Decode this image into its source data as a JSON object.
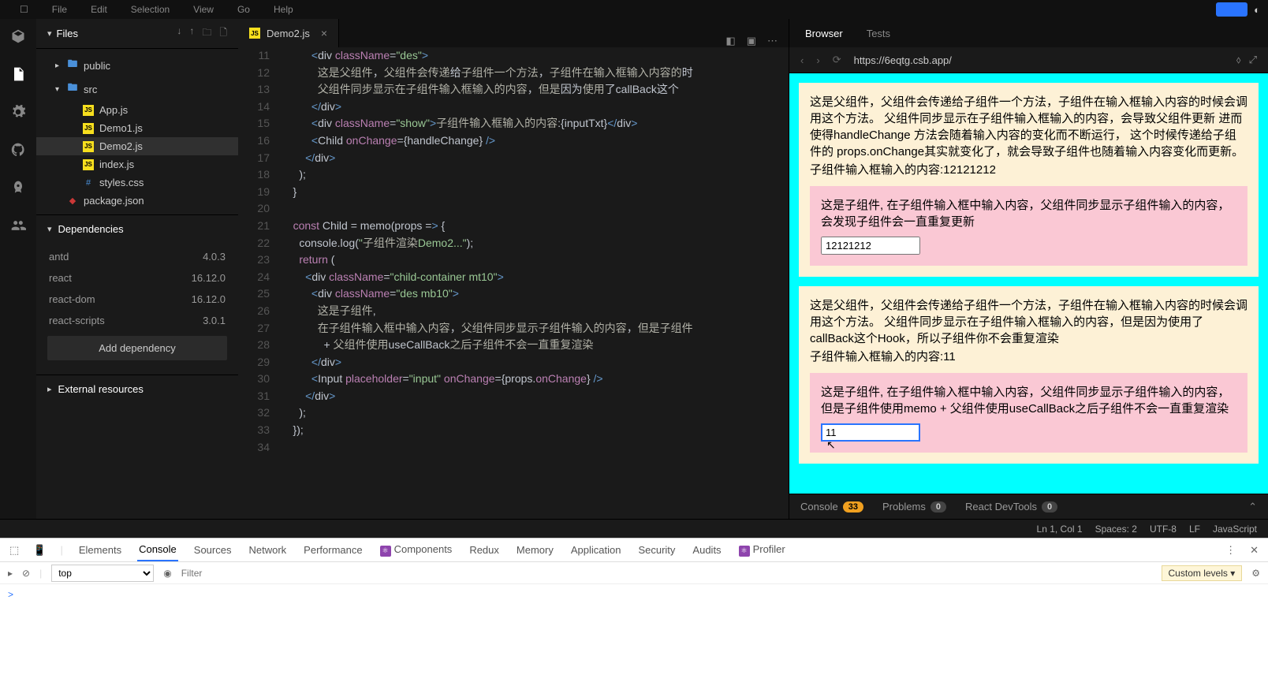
{
  "topmenu": [
    "File",
    "Edit",
    "Selection",
    "View",
    "Go",
    "Help"
  ],
  "sidebar": {
    "files_label": "Files",
    "tree": [
      {
        "chev": "▸",
        "icon": "folder",
        "label": "public",
        "indent": 1
      },
      {
        "chev": "▾",
        "icon": "folder",
        "label": "src",
        "indent": 1
      },
      {
        "icon": "js",
        "label": "App.js",
        "indent": 2
      },
      {
        "icon": "js",
        "label": "Demo1.js",
        "indent": 2
      },
      {
        "icon": "js",
        "label": "Demo2.js",
        "indent": 2,
        "active": true
      },
      {
        "icon": "js",
        "label": "index.js",
        "indent": 2
      },
      {
        "icon": "css",
        "label": "styles.css",
        "indent": 2
      },
      {
        "icon": "npm",
        "label": "package.json",
        "indent": 1
      }
    ],
    "deps_label": "Dependencies",
    "deps": [
      {
        "name": "antd",
        "ver": "4.0.3"
      },
      {
        "name": "react",
        "ver": "16.12.0"
      },
      {
        "name": "react-dom",
        "ver": "16.12.0"
      },
      {
        "name": "react-scripts",
        "ver": "3.0.1"
      }
    ],
    "add_dep": "Add dependency",
    "ext_label": "External resources"
  },
  "tab": {
    "file": "Demo2.js"
  },
  "code": {
    "start": 11,
    "lines": [
      "          <div className=\"des\">",
      "            这是父组件，父组件会传递给子组件一个方法，子组件在输入框输入内容的时",
      "            父组件同步显示在子组件输入框输入的内容，但是因为使用了callBack这个",
      "          </div>",
      "          <div className=\"show\">子组件输入框输入的内容:{inputTxt}</div>",
      "          <Child onChange={handleChange} />",
      "        </div>",
      "      );",
      "    }",
      "",
      "    const Child = memo(props => {",
      "      console.log(\"子组件渲染Demo2...\");",
      "      return (",
      "        <div className=\"child-container mt10\">",
      "          <div className=\"des mb10\">",
      "            这是子组件,",
      "            在子组件输入框中输入内容，父组件同步显示子组件输入的内容，但是子组件",
      "              + 父组件使用useCallBack之后子组件不会一直重复渲染",
      "          </div>",
      "          <Input placeholder=\"input\" onChange={props.onChange} />",
      "        </div>",
      "      );",
      "    });",
      ""
    ]
  },
  "preview": {
    "tab_browser": "Browser",
    "tab_tests": "Tests",
    "url": "https://6eqtg.csb.app/",
    "parent1_text": "这是父组件，父组件会传递给子组件一个方法，子组件在输入框输入内容的时候会调用这个方法。 父组件同步显示在子组件输入框输入的内容，会导致父组件更新 进而使得handleChange 方法会随着输入内容的变化而不断运行， 这个时候传递给子组件的 props.onChange其实就变化了，就会导致子组件也随着输入内容变化而更新。",
    "parent1_show": "子组件输入框输入的内容:12121212",
    "child1_text": "这是子组件, 在子组件输入框中输入内容，父组件同步显示子组件输入的内容，会发现子组件会一直重复更新",
    "child1_input": "12121212",
    "parent2_text": "这是父组件，父组件会传递给子组件一个方法，子组件在输入框输入内容的时候会调用这个方法。 父组件同步显示在子组件输入框输入的内容，但是因为使用了callBack这个Hook，所以子组件你不会重复渲染",
    "parent2_show": "子组件输入框输入的内容:11",
    "child2_text": "这是子组件, 在子组件输入框中输入内容，父组件同步显示子组件输入的内容，但是子组件使用memo + 父组件使用useCallBack之后子组件不会一直重复渲染",
    "child2_input": "11",
    "bottom": {
      "console": "Console",
      "console_count": "33",
      "problems": "Problems",
      "problems_count": "0",
      "reactdt": "React DevTools",
      "reactdt_count": "0"
    }
  },
  "status": {
    "pos": "Ln 1, Col 1",
    "spaces": "Spaces: 2",
    "encoding": "UTF-8",
    "eol": "LF",
    "lang": "JavaScript"
  },
  "devtools": {
    "tabs": [
      "Elements",
      "Console",
      "Sources",
      "Network",
      "Performance",
      "Components",
      "Redux",
      "Memory",
      "Application",
      "Security",
      "Audits",
      "Profiler"
    ],
    "active_tab": "Console",
    "top_label": "top",
    "filter_placeholder": "Filter",
    "levels": "Custom levels ▾",
    "prompt": ">"
  }
}
